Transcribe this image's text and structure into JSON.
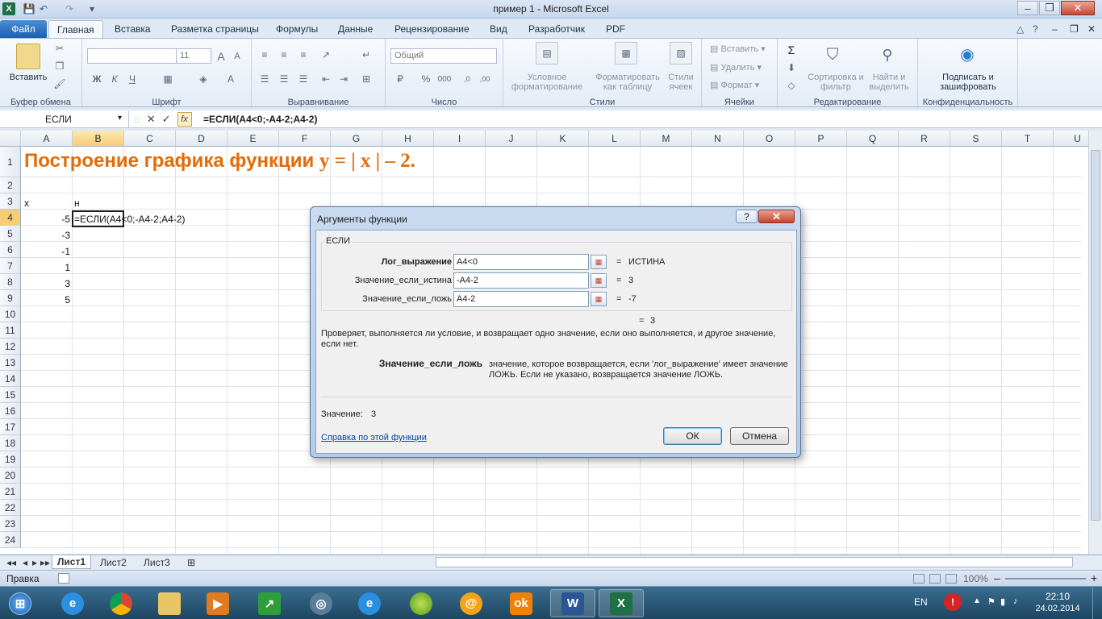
{
  "window": {
    "title": "пример 1  -  Microsoft Excel"
  },
  "qat": {
    "logo": "X",
    "save": "💾",
    "undo": "↶",
    "redo": "↷",
    "more": "▾"
  },
  "winctrl": {
    "min": "–",
    "max": "❐",
    "close": "✕"
  },
  "tabs": [
    "Файл",
    "Главная",
    "Вставка",
    "Разметка страницы",
    "Формулы",
    "Данные",
    "Рецензирование",
    "Вид",
    "Разработчик",
    "PDF"
  ],
  "tabicons": {
    "minimize": "△",
    "help": "?",
    "min": "–",
    "restore": "❐",
    "close": "✕"
  },
  "ribbon": {
    "clipboard": {
      "paste": "Вставить",
      "label": "Буфер обмена"
    },
    "font": {
      "size": "11",
      "bold": "Ж",
      "italic": "К",
      "underline": "Ч",
      "grow": "A",
      "shrink": "A",
      "label": "Шрифт"
    },
    "align": {
      "label": "Выравнивание"
    },
    "number": {
      "format": "Общий",
      "percent": "%",
      "thousand": "000",
      "label": "Число"
    },
    "styles": {
      "cond": "Условное форматирование",
      "table": "Форматировать как таблицу",
      "cells": "Стили ячеек",
      "label": "Стили"
    },
    "cells": {
      "insert": "Вставить",
      "delete": "Удалить",
      "format": "Формат",
      "label": "Ячейки"
    },
    "editing": {
      "sum": "Σ",
      "sort": "Сортировка и фильтр",
      "find": "Найти и выделить",
      "label": "Редактирование"
    },
    "privacy": {
      "sign": "Подписать и зашифровать",
      "label": "Конфиденциальность"
    }
  },
  "formula_bar": {
    "name": "ЕСЛИ",
    "cancel": "✕",
    "enter": "✓",
    "fx": "fx",
    "formula": "=ЕСЛИ(A4<0;-A4-2;A4-2)"
  },
  "columns": [
    "A",
    "B",
    "C",
    "D",
    "E",
    "F",
    "G",
    "H",
    "I",
    "J",
    "K",
    "L",
    "M",
    "N",
    "O",
    "P",
    "Q",
    "R",
    "S",
    "T",
    "U"
  ],
  "rows": [
    "1",
    "2",
    "3",
    "4",
    "5",
    "6",
    "7",
    "8",
    "9",
    "10",
    "11",
    "12",
    "13",
    "14",
    "15",
    "16",
    "17",
    "18",
    "19",
    "20",
    "21",
    "22",
    "23",
    "24"
  ],
  "sheet": {
    "title_text": "Построение графика функции ",
    "title_math": "y = | x | – 2.",
    "a3": "x",
    "b3": "н",
    "xvalues": [
      "-5",
      "-3",
      "-1",
      "1",
      "3",
      "5"
    ],
    "b4": "=ЕСЛИ(A4<0;-A4-2;A4-2)"
  },
  "sheettabs": {
    "nav": [
      "◂◂",
      "◂",
      "▸",
      "▸▸"
    ],
    "tabs": [
      "Лист1",
      "Лист2",
      "Лист3"
    ],
    "newsheet": "⊞"
  },
  "status": {
    "mode": "Правка",
    "zoom": "100%",
    "minus": "–",
    "plus": "+"
  },
  "taskbar": {
    "lang": "EN",
    "time": "22:10",
    "date": "24.02.2014"
  },
  "dialog": {
    "title": "Аргументы функции",
    "help": "?",
    "close": "✕",
    "func": "ЕСЛИ",
    "args": [
      {
        "label": "Лог_выражение",
        "value": "A4<0",
        "result": "ИСТИНА"
      },
      {
        "label": "Значение_если_истина",
        "value": "-A4-2",
        "result": "3"
      },
      {
        "label": "Значение_если_ложь",
        "value": "A4-2",
        "result": "-7"
      }
    ],
    "eq": "=",
    "overall": "3",
    "description": "Проверяет, выполняется ли условие, и возвращает одно значение, если оно выполняется, и другое значение, если нет.",
    "argname": "Значение_если_ложь",
    "argdesc": "значение, которое возвращается, если 'лог_выражение' имеет значение ЛОЖЬ. Если не указано, возвращается значение ЛОЖЬ.",
    "value_label": "Значение:",
    "value": "3",
    "help_link": "Справка по этой функции",
    "ok": "ОК",
    "cancel": "Отмена"
  }
}
